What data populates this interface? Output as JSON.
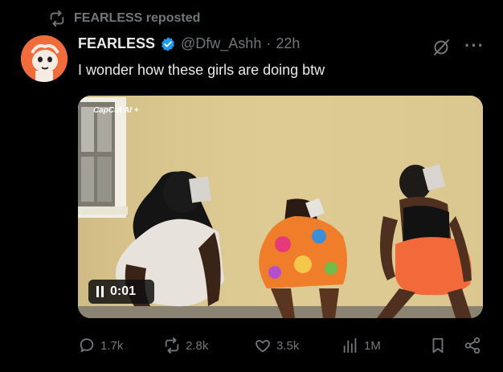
{
  "repost": {
    "label": "FEARLESS reposted",
    "icon": "repost-icon"
  },
  "post": {
    "author_name": "FEARLESS",
    "verified": true,
    "handle": "@Dfw_Ashh",
    "separator": "·",
    "time": "22h",
    "text": "I wonder how these girls are doing btw"
  },
  "media": {
    "watermark": "CapCut AI +",
    "timestamp": "0:01",
    "state": "pause-icon"
  },
  "actions": {
    "replies": "1.7k",
    "reposts": "2.8k",
    "likes": "3.5k",
    "views": "1M"
  },
  "colors": {
    "background": "#000000",
    "text_primary": "#e7e9ea",
    "text_secondary": "#71767b",
    "verified_blue": "#1d9bf0",
    "avatar_bg": "#f26b3a"
  }
}
